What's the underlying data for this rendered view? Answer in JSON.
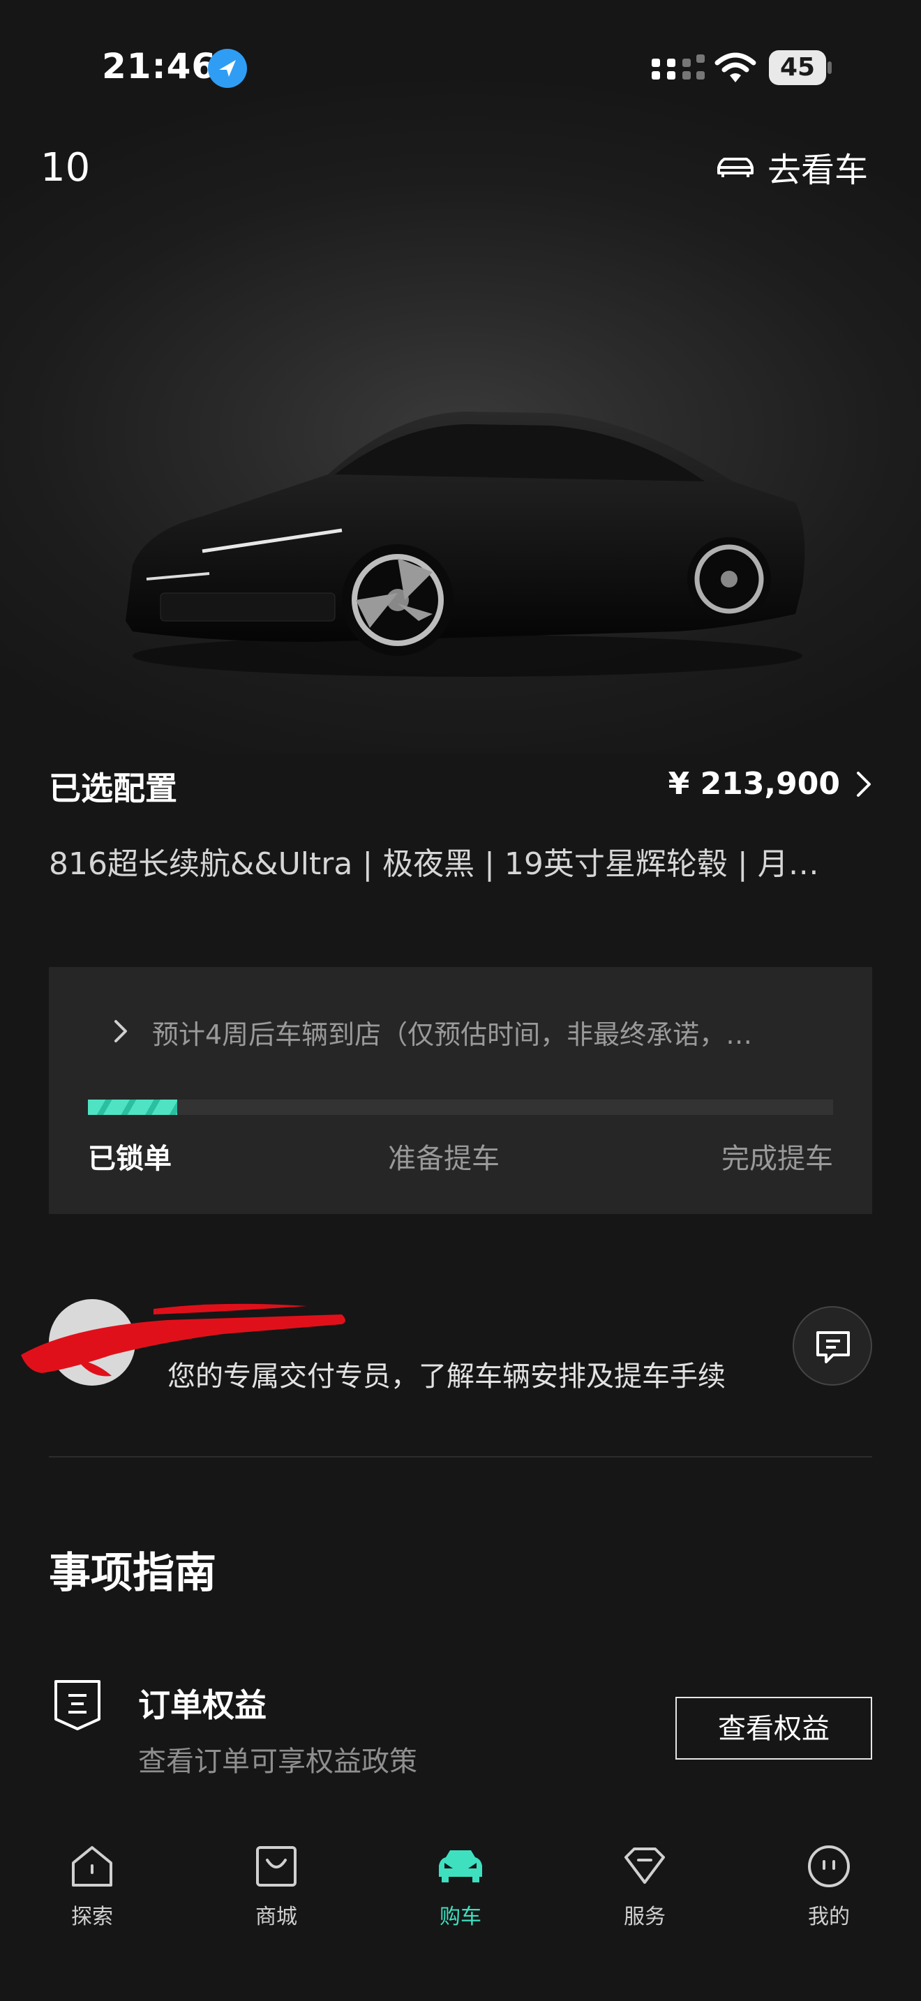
{
  "status_bar": {
    "time": "21:46",
    "battery": "45"
  },
  "header": {
    "model": "10",
    "see_car_label": "去看车"
  },
  "config": {
    "title": "已选配置",
    "price": "¥ 213,900",
    "description": "816超长续航&&Ultra | 极夜黑 | 19英寸星辉轮毂 | 月…"
  },
  "progress": {
    "eta_text": "预计4周后车辆到店（仅预估时间，非最终承诺，…",
    "fill_fraction": 0.12,
    "steps": [
      "已锁单",
      "准备提车",
      "完成提车"
    ],
    "active_step": 0
  },
  "advisor": {
    "description": "您的专属交付专员，了解车辆安排及提车手续"
  },
  "guide": {
    "title": "事项指南",
    "item": {
      "title": "订单权益",
      "desc": "查看订单可享权益政策",
      "button": "查看权益"
    }
  },
  "tabbar": {
    "items": [
      {
        "label": "探索",
        "icon": "home-icon"
      },
      {
        "label": "商城",
        "icon": "shopping-bag-icon"
      },
      {
        "label": "购车",
        "icon": "car-icon"
      },
      {
        "label": "服务",
        "icon": "diamond-icon"
      },
      {
        "label": "我的",
        "icon": "profile-face-icon"
      }
    ],
    "active_index": 2,
    "active_color": "#3ee0c0"
  },
  "colors": {
    "accent": "#3ee0c0",
    "background": "#161616",
    "card": "#262626"
  }
}
